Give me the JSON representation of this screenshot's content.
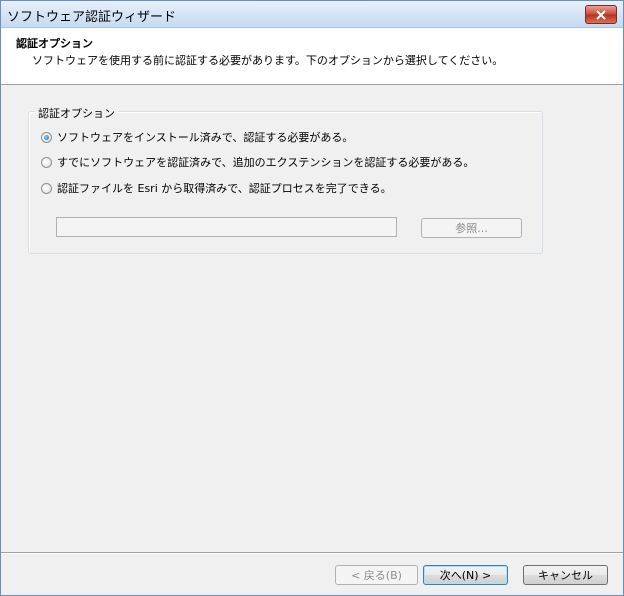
{
  "window": {
    "title": "ソフトウェア認証ウィザード"
  },
  "header": {
    "title": "認証オプション",
    "subtitle": "ソフトウェアを使用する前に認証する必要があります。下のオプションから選択してください。"
  },
  "options_group": {
    "label": "認証オプション",
    "options": [
      {
        "label": "ソフトウェアをインストール済みで、認証する必要がある。",
        "checked": true
      },
      {
        "label": "すでにソフトウェアを認証済みで、追加のエクステンションを認証する必要がある。",
        "checked": false
      },
      {
        "label": "認証ファイルを Esri から取得済みで、認証プロセスを完了できる。",
        "checked": false
      }
    ],
    "file_path_value": "",
    "browse_label": "参照..."
  },
  "footer": {
    "back_label": "< 戻る(B)",
    "next_label": "次へ(N) >",
    "cancel_label": "キャンセル"
  }
}
